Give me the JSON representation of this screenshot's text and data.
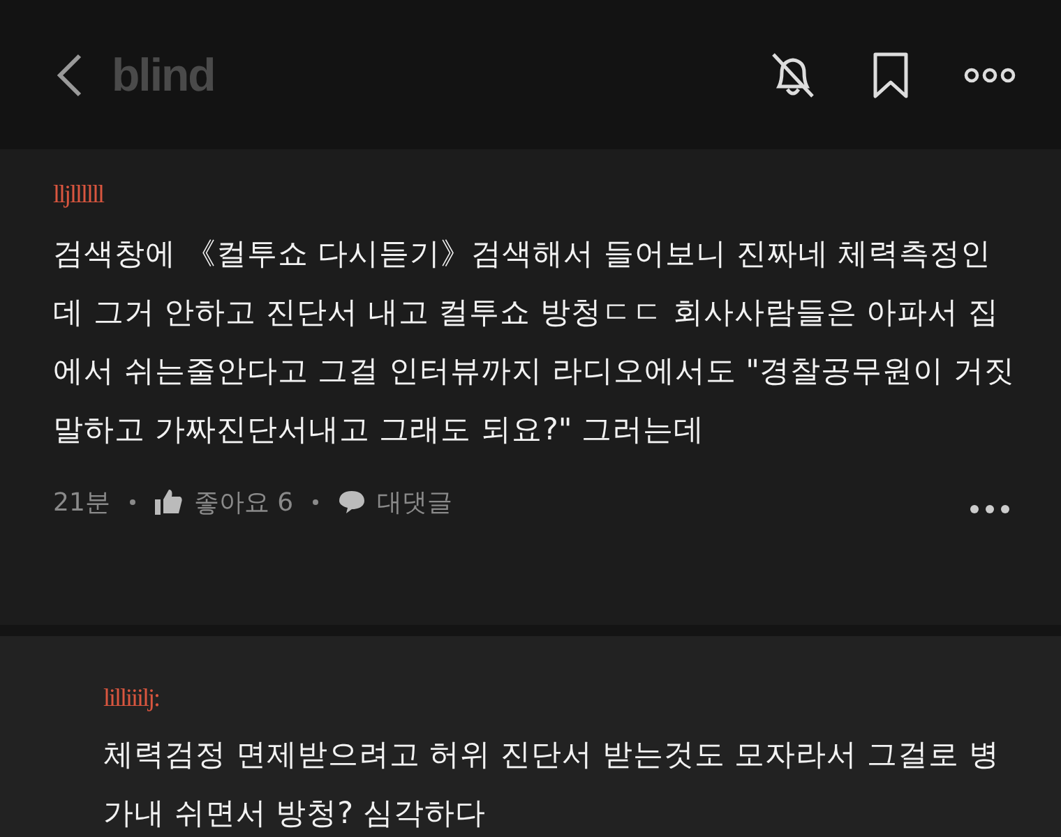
{
  "header": {
    "logo": "blind",
    "bell_muted": true
  },
  "comment": {
    "author": "lljllllll",
    "body": "검색창에 《컬투쇼 다시듣기》검색해서 들어보니 진짜네 체력측정인데 그거 안하고 진단서 내고 컬투쇼 방청ㄷㄷ 회사사람들은 아파서 집에서 쉬는줄안다고 그걸 인터뷰까지 라디오에서도 \"경찰공무원이 거짓말하고 가짜진단서내고 그래도 되요?\" 그러는데",
    "time": "21분",
    "likes": "좋아요 6",
    "reply_label": "대댓글"
  },
  "reply": {
    "author": "lilliiilj:",
    "body": "체력검정 면제받으려고 허위 진단서 받는것도 모자라서 그걸로 병가내 쉬면서 방청? 심각하다"
  }
}
